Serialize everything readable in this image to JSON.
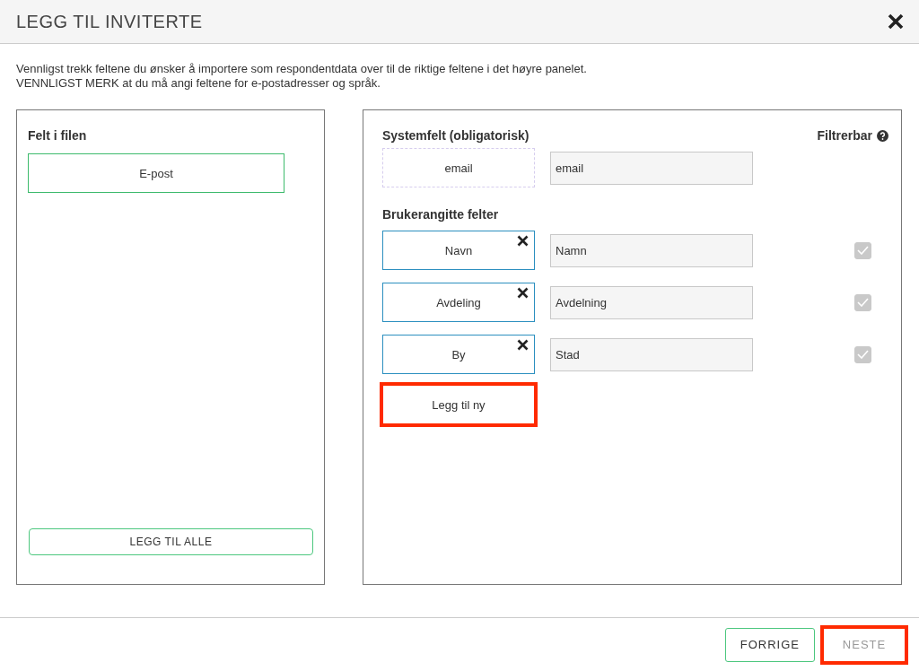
{
  "dialog": {
    "title": "LEGG TIL INVITERTE"
  },
  "instructions": [
    "Vennligst trekk feltene du ønsker å importere som respondentdata over til de riktige feltene i det høyre panelet.",
    "VENNLIGST MERK at du må angi feltene for e-postadresser og språk."
  ],
  "file_panel": {
    "heading": "Felt i filen",
    "fields": [
      "E-post"
    ],
    "add_all_button": "LEGG TIL ALLE"
  },
  "mapping_panel": {
    "system_heading": "Systemfelt (obligatorisk)",
    "filterable_heading": "Filtrerbar",
    "system_fields": [
      {
        "source": "email",
        "value": "email"
      }
    ],
    "user_heading": "Brukerangitte felter",
    "user_fields": [
      {
        "source": "Navn",
        "value": "Namn",
        "filterable": true
      },
      {
        "source": "Avdeling",
        "value": "Avdelning",
        "filterable": true
      },
      {
        "source": "By",
        "value": "Stad",
        "filterable": true
      }
    ],
    "add_new_button": {
      "label": "Legg til ny",
      "highlighted": true
    }
  },
  "footer": {
    "buttons": [
      {
        "label": "FORRIGE",
        "disabled": false,
        "highlighted": false
      },
      {
        "label": "NESTE",
        "disabled": true,
        "highlighted": true
      }
    ]
  }
}
